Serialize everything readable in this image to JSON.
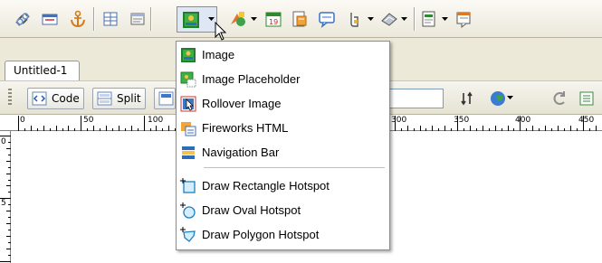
{
  "document": {
    "tab_label": "Untitled-1",
    "views": {
      "code": "Code",
      "split": "Split"
    }
  },
  "rulers": {
    "top_labels": [
      "0",
      "50",
      "100",
      "300",
      "350",
      "400",
      "450"
    ],
    "left_labels": [
      "0",
      "5"
    ]
  },
  "image_menu": {
    "items": [
      {
        "label": "Image",
        "icon": "image-icon"
      },
      {
        "label": "Image Placeholder",
        "icon": "image-placeholder-icon"
      },
      {
        "label": "Rollover Image",
        "icon": "rollover-image-icon"
      },
      {
        "label": "Fireworks HTML",
        "icon": "fireworks-html-icon"
      },
      {
        "label": "Navigation Bar",
        "icon": "navigation-bar-icon"
      },
      {
        "label": "Draw Rectangle Hotspot",
        "icon": "rectangle-hotspot-icon"
      },
      {
        "label": "Draw Oval Hotspot",
        "icon": "oval-hotspot-icon"
      },
      {
        "label": "Draw Polygon Hotspot",
        "icon": "polygon-hotspot-icon"
      }
    ]
  },
  "insert_toolbar": {
    "icons": [
      "hyperlink-icon",
      "email-link-icon",
      "named-anchor-icon",
      "table-icon",
      "layer-icon",
      "images-icon",
      "media-icon",
      "date-icon",
      "server-side-include-icon",
      "comment-icon",
      "head-icon",
      "script-icon",
      "templates-icon",
      "tag-chooser-icon"
    ]
  },
  "colors": {
    "menu_border": "#8d8d8d",
    "toolbar_bg": "#ece9d8"
  }
}
